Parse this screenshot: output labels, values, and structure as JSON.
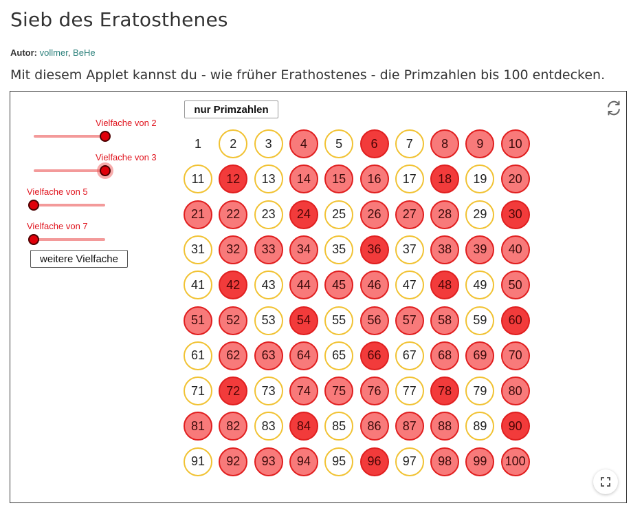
{
  "header": {
    "title": "Sieb des Eratosthenes",
    "author_label": "Autor:",
    "author_name_1": "vollmer",
    "author_separator": ", ",
    "author_name_2": "BeHe",
    "description": "Mit diesem Applet kannst du - wie früher Erathostenes - die Primzahlen bis 100 entdecken."
  },
  "applet": {
    "sliders": [
      {
        "label": "Vielfache von 2",
        "value": 1
      },
      {
        "label": "Vielfache von 3",
        "value": 1
      },
      {
        "label": "Vielfache von 5",
        "value": 0
      },
      {
        "label": "Vielfache von 7",
        "value": 0
      }
    ],
    "buttons": {
      "more_multiples": "weitere Vielfache",
      "only_primes": "nur Primzahlen"
    },
    "icons": {
      "reset": "refresh-icon",
      "fullscreen": "fullscreen-icon"
    },
    "colors": {
      "prime_border": "#f1c232",
      "marked_once_fill": "#f87a7a",
      "marked_twice_fill": "#f23b3b",
      "marked_border": "#e01e1e",
      "slider_label": "#e0141e"
    },
    "grid_rows": 10,
    "grid_cols": 10,
    "numbers": [
      1,
      2,
      3,
      4,
      5,
      6,
      7,
      8,
      9,
      10,
      11,
      12,
      13,
      14,
      15,
      16,
      17,
      18,
      19,
      20,
      21,
      22,
      23,
      24,
      25,
      26,
      27,
      28,
      29,
      30,
      31,
      32,
      33,
      34,
      35,
      36,
      37,
      38,
      39,
      40,
      41,
      42,
      43,
      44,
      45,
      46,
      47,
      48,
      49,
      50,
      51,
      52,
      53,
      54,
      55,
      56,
      57,
      58,
      59,
      60,
      61,
      62,
      63,
      64,
      65,
      66,
      67,
      68,
      69,
      70,
      71,
      72,
      73,
      74,
      75,
      76,
      77,
      78,
      79,
      80,
      81,
      82,
      83,
      84,
      85,
      86,
      87,
      88,
      89,
      90,
      91,
      92,
      93,
      94,
      95,
      96,
      97,
      98,
      99,
      100
    ],
    "marks_legend": {
      "plain": "not marked (1)",
      "prime": "yellow ring",
      "m1": "light red",
      "m2": "dark red"
    }
  }
}
